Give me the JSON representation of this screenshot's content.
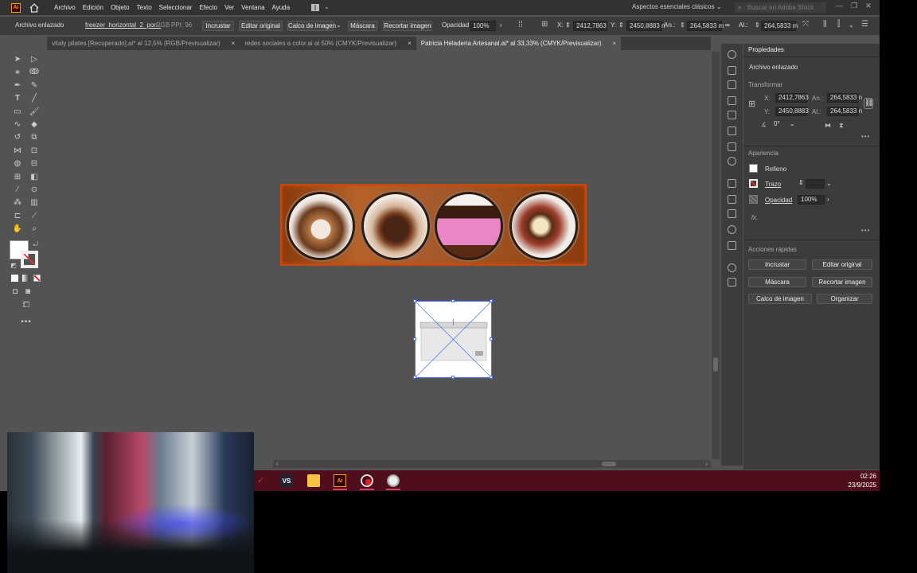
{
  "menubar": {
    "logo": "Ai",
    "items": [
      "Archivo",
      "Edición",
      "Objeto",
      "Texto",
      "Seleccionar",
      "Efecto",
      "Ver",
      "Ventana",
      "Ayuda"
    ],
    "workspace": "Aspectos esenciales clásicos",
    "search_placeholder": "Buscar en Adobe Stock"
  },
  "control_bar": {
    "object_type": "Archivo enlazado",
    "filename": "freezer_horizontal_2_por...",
    "color_mode": "RGB",
    "ppi": "PPI: 96",
    "embed": "Incrustar",
    "edit_original": "Editar original",
    "image_trace": "Calco de imagen",
    "mask": "Máscara",
    "crop_image": "Recortar imagen",
    "opacity_label": "Opacidad:",
    "opacity_value": "100%",
    "x_label": "X:",
    "x_value": "2412,7863",
    "y_label": "Y:",
    "y_value": "2450,8883 n",
    "w_label": "An.:",
    "w_value": "264,5833 m",
    "h_label": "Al.:",
    "h_value": "264,5833 m"
  },
  "tabs": [
    {
      "label": "vitaly pilates [Recuperado].ai* al 12,5% (RGB/Previsualizar)",
      "close": "×",
      "active": false
    },
    {
      "label": "redes sociales a color.ai al 50% (CMYK/Previsualizar)",
      "close": "×",
      "active": false
    },
    {
      "label": "Patricia Heladeria Artesanal.ai* al 33,33% (CMYK/Previsualizar)",
      "close": "×",
      "active": true
    }
  ],
  "properties": {
    "panel_title": "Propiedades",
    "object_type": "Archivo enlazado",
    "transform_title": "Transformar",
    "x_label": "X:",
    "x_value": "2412,7863",
    "y_label": "Y:",
    "y_value": "2450,8883",
    "w_label": "An.:",
    "w_value": "264,5833 n",
    "h_label": "Al.:",
    "h_value": "264,5833 n",
    "angle_value": "0°",
    "appearance_title": "Apariencia",
    "fill_label": "Relleno",
    "stroke_label": "Trazo",
    "opacity_label": "Opacidad",
    "opacity_value": "100%",
    "fx_label": "fx.",
    "quick_actions_title": "Acciones rápidas",
    "btn_embed": "Incrustar",
    "btn_edit_original": "Editar original",
    "btn_mask": "Máscara",
    "btn_crop": "Recortar imagen",
    "btn_trace": "Calco de imagen",
    "btn_arrange": "Organizar"
  },
  "taskbar": {
    "time": "02:26",
    "date": "23/9/2025",
    "ai_icon": "Ai",
    "vs_icon": "VS"
  },
  "colors": {
    "banner_border": "#c64a0e",
    "selection": "#4a6cff",
    "taskbar": "#4e0e1b",
    "ai_orange": "#ff9a00"
  }
}
